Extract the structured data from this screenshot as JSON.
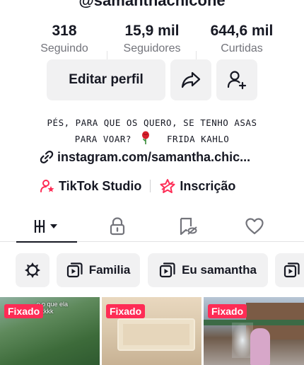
{
  "profile": {
    "username": "@samanthachicone",
    "stats": [
      {
        "value": "318",
        "label": "Seguindo"
      },
      {
        "value": "15,9 mil",
        "label": "Seguidores"
      },
      {
        "value": "644,6 mil",
        "label": "Curtidas"
      }
    ],
    "edit_button": "Editar perfil",
    "bio_line1": "Pés, para que os quero, se tenho asas",
    "bio_line2_a": "para voar?",
    "bio_line2_b": "Frida Kahlo",
    "link": "instagram.com/samantha.chic...",
    "studio_label": "TikTok Studio",
    "subscribe_label": "Inscrição"
  },
  "tabs": [
    "videos-grid-icon",
    "lock-icon",
    "reposts-icon",
    "heart-icon"
  ],
  "playlists": [
    {
      "icon": "playlist-icon",
      "label": "Familia"
    },
    {
      "icon": "playlist-icon",
      "label": "Eu samantha"
    }
  ],
  "videos": [
    {
      "pin": "Fixado",
      "caption": "...e o que ela\nkkkkkkk"
    },
    {
      "pin": "Fixado"
    },
    {
      "pin": "Fixado"
    }
  ],
  "colors": {
    "accent": "#fe2c55",
    "text": "#161823",
    "muted": "#73747b",
    "chip_bg": "#f1f1f2"
  }
}
